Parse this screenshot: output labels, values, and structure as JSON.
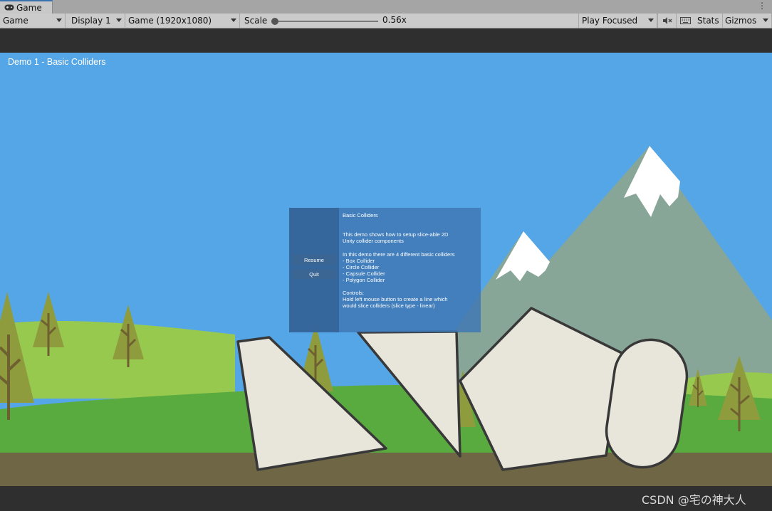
{
  "window": {
    "tab_label": "Game",
    "tab_icon": "gamepad-icon",
    "menu_glyph": "⋮"
  },
  "toolbar": {
    "view_mode": "Game",
    "display": "Display 1",
    "resolution": "Game (1920x1080)",
    "scale_label": "Scale",
    "scale_value": "0.56x",
    "play_mode": "Play Focused",
    "mute_icon": "mute-audio-icon",
    "keyboard_icon": "keyboard-icon",
    "stats_label": "Stats",
    "gizmos_label": "Gizmos"
  },
  "game": {
    "demo_title": "Demo 1 - Basic Colliders",
    "pause_menu": {
      "resume_label": "Resume",
      "quit_label": "Quit",
      "heading": "Basic Colliders",
      "intro": "This demo shows how to setup slice-able 2D\nUnity collider components",
      "list_intro": "In this demo there are 4 different basic colliders",
      "colliders": [
        "- Box Collider",
        "- Circle Collider",
        "- Capsule Collider",
        "- Polygon Collider"
      ],
      "controls_heading": "Controls:",
      "controls_text": "Hold left mouse button to create a line which\nwould slice colliders (slice type - linear)"
    }
  },
  "watermark": "CSDN @宅の神大人",
  "colors": {
    "sky": "#55a6e6",
    "mountain": "#88a698",
    "snow": "#ffffff",
    "hill_far": "#98c94f",
    "hill_near": "#5aab3f",
    "ground": "#6e6644",
    "shape_fill": "#e8e6da",
    "shape_stroke": "#383838",
    "tree": "#8e9c3e"
  }
}
